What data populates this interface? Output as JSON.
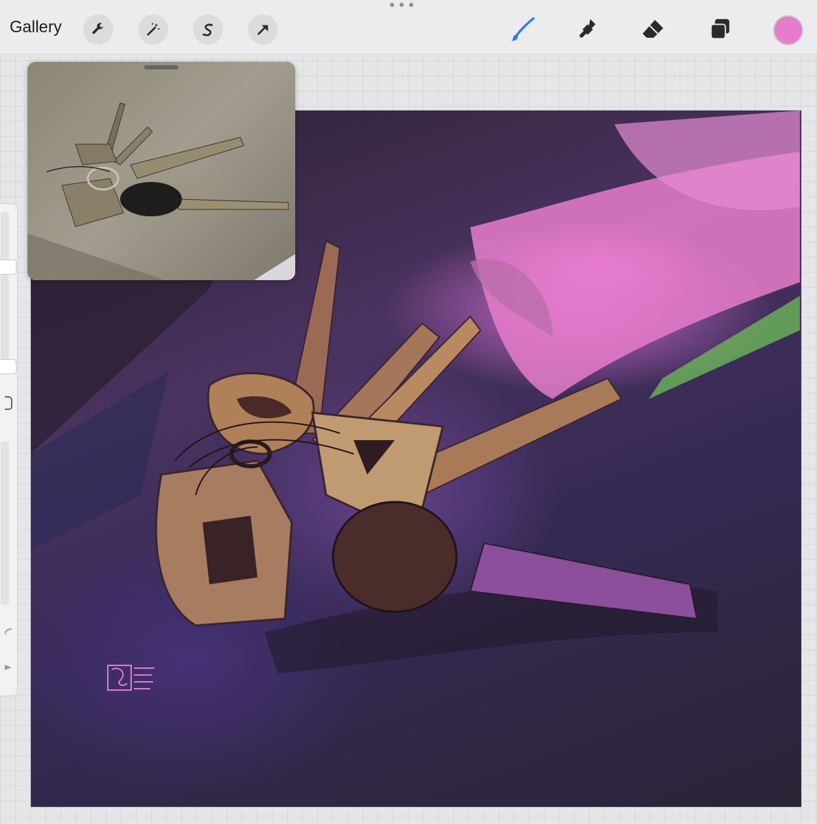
{
  "toolbar": {
    "gallery_label": "Gallery",
    "left_icons": [
      "wrench-icon",
      "magic-wand-icon",
      "selection-s-icon",
      "transform-arrow-icon"
    ],
    "right_icons": [
      "brush-icon",
      "smudge-icon",
      "eraser-icon",
      "layers-icon"
    ],
    "active_tool": "brush",
    "active_color": "#e67ccb",
    "brush_active_color": "#2f7fe0"
  },
  "sidebar": {
    "brush_size": 0.12,
    "opacity": 0.15
  },
  "reference_window": {
    "visible": true
  },
  "canvas": {
    "palette": {
      "pink": "#e67ccb",
      "purple": "#4a3360",
      "brass": "#b48a5a",
      "green": "#6fbf5a"
    }
  }
}
